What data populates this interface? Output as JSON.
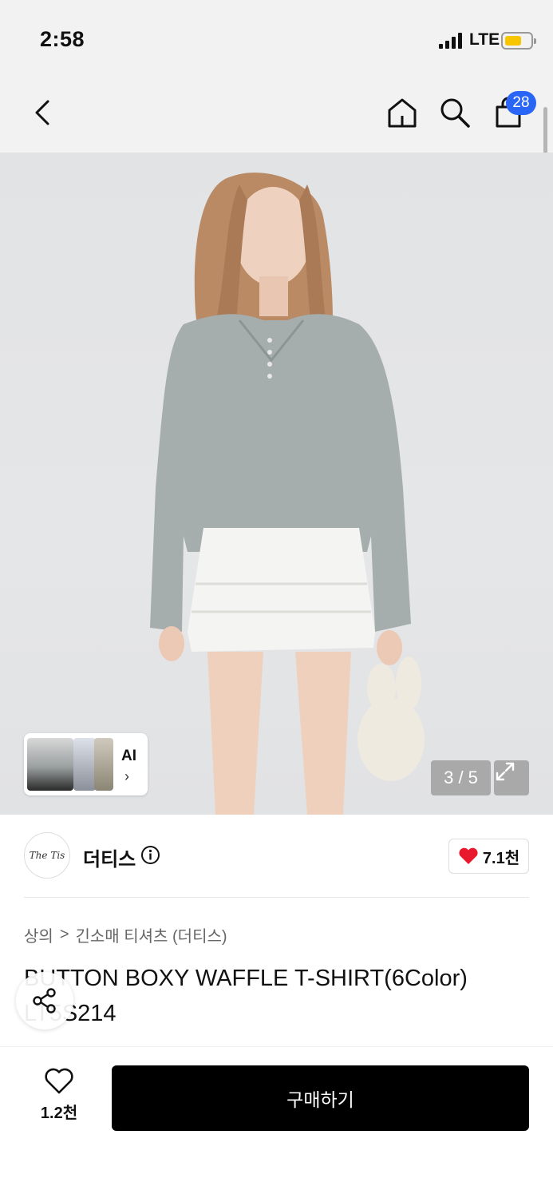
{
  "status_bar": {
    "time": "2:58",
    "network": "LTE"
  },
  "nav": {
    "cart_count": "28"
  },
  "hero": {
    "ai_label": "AI",
    "page_indicator": "3 / 5"
  },
  "brand": {
    "logo_text": "The Tis",
    "name": "더티스",
    "like_count": "7.1천"
  },
  "breadcrumb": {
    "category": "상의",
    "separator": ">",
    "subcategory": "긴소매 티셔츠 (더티스)"
  },
  "product": {
    "title": "BUTTON BOXY WAFFLE T-SHIRT(6Color) LT5S214"
  },
  "bottom_bar": {
    "wish_count": "1.2천",
    "buy_label": "구매하기"
  },
  "colors": {
    "accent": "#2a66f6",
    "heart": "#e8192c",
    "buy_button": "#000000"
  }
}
